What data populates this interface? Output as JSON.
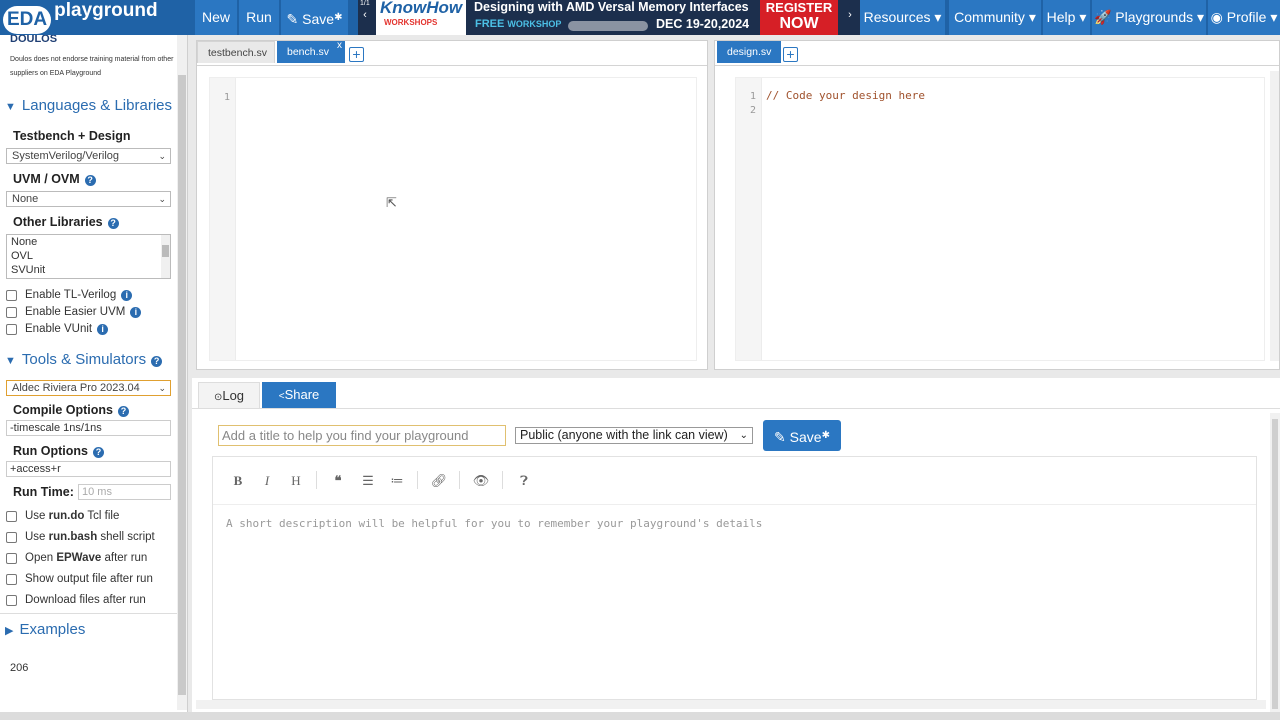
{
  "logo": {
    "eda": "EDA",
    "playground": "playground"
  },
  "nav": {
    "new": "New",
    "run": "Run",
    "save": "Save",
    "save_star": "✱",
    "resources": "Resources ▾",
    "community": "Community ▾",
    "help": "Help ▾",
    "playgrounds": "Playgrounds ▾",
    "profile": "Profile ▾"
  },
  "banner": {
    "page": "1/1",
    "knowhow": "KnowHow",
    "workshops": "WORKSHOPS",
    "title": "Designing with AMD Versal Memory Interfaces",
    "free": "FREE",
    "workshop": "WORKSHOP",
    "date": "DEC 19-20,2024",
    "register1": "REGISTER",
    "register2": "NOW"
  },
  "sidebar": {
    "doulos": "DOULOS",
    "doulos_note": "Doulos does not endorse training material from other suppliers on EDA Playground",
    "languages_header": "Languages & Libraries",
    "testbench_label": "Testbench + Design",
    "testbench_value": "SystemVerilog/Verilog",
    "uvm_label": "UVM / OVM",
    "uvm_value": "None",
    "other_libs_label": "Other Libraries",
    "other_libs": [
      "None",
      "OVL",
      "SVUnit"
    ],
    "enable_tl": "Enable TL-Verilog",
    "enable_easier": "Enable Easier UVM",
    "enable_vunit": "Enable VUnit",
    "tools_header": "Tools & Simulators",
    "simulator_value": "Aldec Riviera Pro 2023.04",
    "compile_label": "Compile Options",
    "compile_value": "-timescale 1ns/1ns",
    "run_opts_label": "Run Options",
    "run_opts_value": "+access+r",
    "run_time_label": "Run Time:",
    "run_time_placeholder": "10 ms",
    "use_rundo_pre": "Use ",
    "use_rundo_b": "run.do",
    "use_rundo_post": " Tcl file",
    "use_runbash_pre": "Use ",
    "use_runbash_b": "run.bash",
    "use_runbash_post": " shell script",
    "open_epwave_pre": "Open ",
    "open_epwave_b": "EPWave",
    "open_epwave_post": " after run",
    "show_output": "Show output file after run",
    "download_files": "Download files after run",
    "examples_header": "Examples",
    "count": "206"
  },
  "editor_left": {
    "tabs": [
      "testbench.sv",
      "bench.sv"
    ],
    "active_close": "x",
    "lines": [
      "1"
    ]
  },
  "editor_right": {
    "tabs": [
      "design.sv"
    ],
    "lines": [
      "1",
      "2"
    ],
    "code": "// Code your design here"
  },
  "bottom": {
    "log_tab": "Log",
    "share_tab": "Share",
    "title_placeholder": "Add a title to help you find your playground",
    "visibility": "Public (anyone with the link can view)",
    "save": "Save",
    "save_star": "✱",
    "description_placeholder": "A short description will be helpful for you to remember your playground's details"
  },
  "colors": {
    "brand": "#1f62a6",
    "accent": "#2b77c2",
    "register": "#d61f26"
  }
}
